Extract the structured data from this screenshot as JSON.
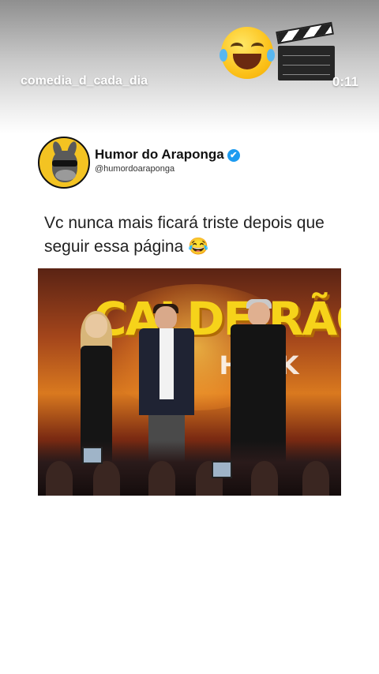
{
  "story": {
    "username": "comedia_d_cada_dia",
    "time": "0:11",
    "stickers": [
      "face-with-tears-of-joy-emoji",
      "clapperboard-emoji"
    ]
  },
  "post": {
    "author_name": "Humor do Araponga",
    "verified_icon": "✔",
    "handle": "@humordoaraponga",
    "text": "Vc nunca mais ficará triste depois que seguir essa página 😂"
  },
  "video": {
    "logo_text": "CALDEIRÃO",
    "logo_subtext": "HUCK"
  },
  "colors": {
    "verified_blue": "#1d9bf0",
    "avatar_yellow": "#f3c322",
    "logo_yellow": "#f6d31a"
  }
}
